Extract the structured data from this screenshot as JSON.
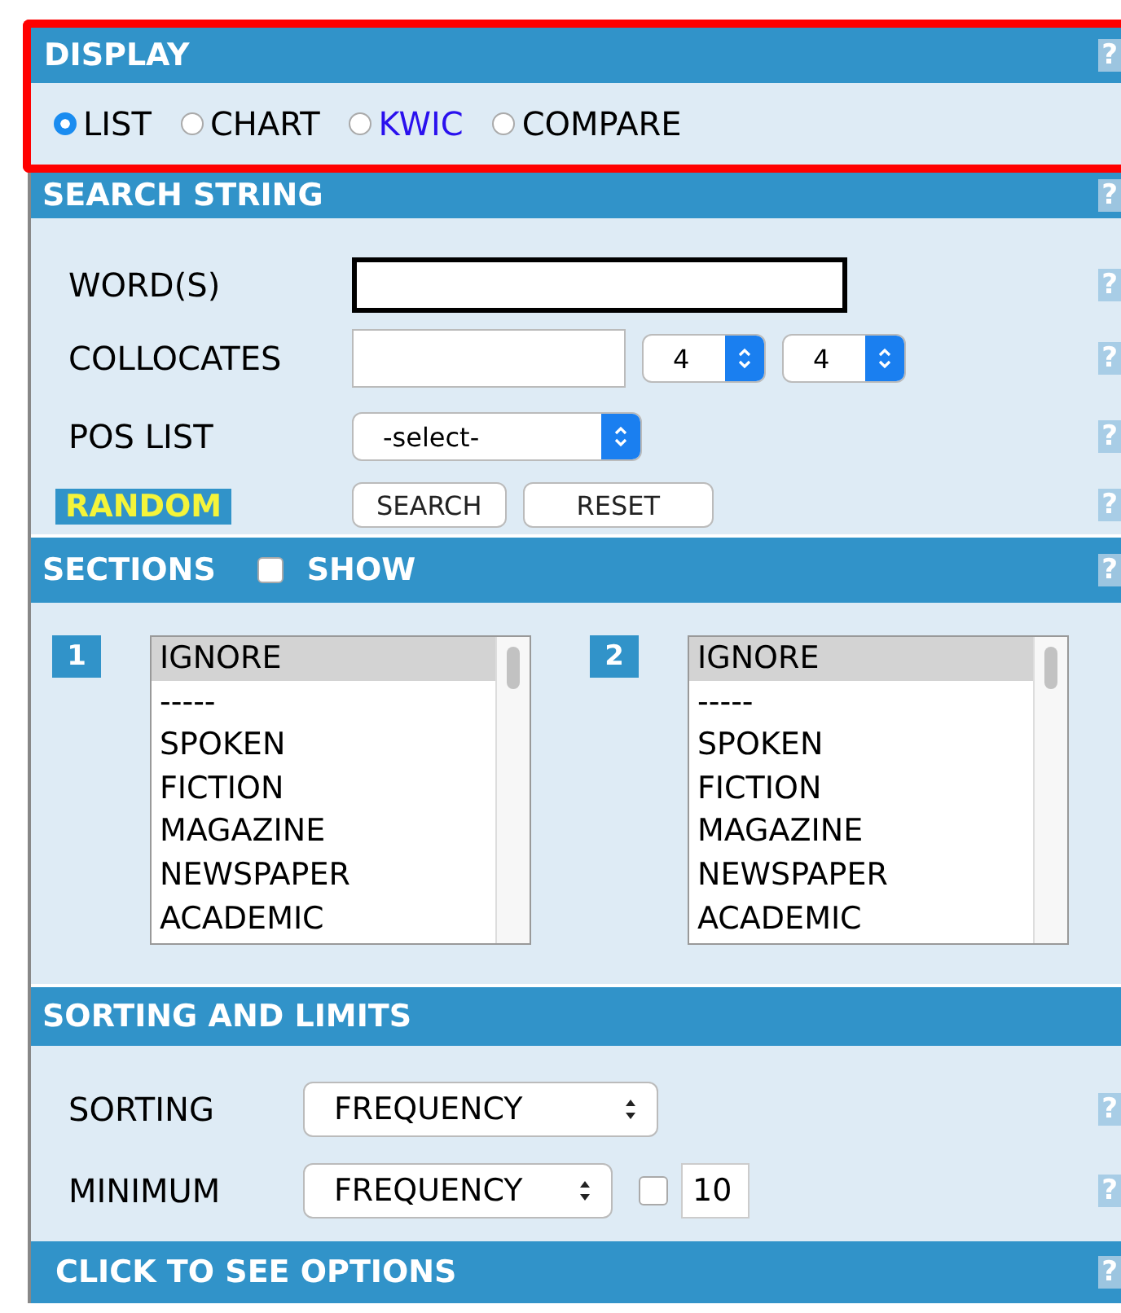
{
  "display": {
    "title": "DISPLAY",
    "help": "?",
    "options": [
      {
        "label": "LIST",
        "selected": true,
        "kind": "text"
      },
      {
        "label": "CHART",
        "selected": false,
        "kind": "text"
      },
      {
        "label": "KWIC",
        "selected": false,
        "kind": "link"
      },
      {
        "label": "COMPARE",
        "selected": false,
        "kind": "text"
      }
    ]
  },
  "search_string": {
    "title": "SEARCH STRING",
    "help": "?",
    "words": {
      "label": "WORD(S)",
      "help": "?"
    },
    "collocates": {
      "label": "COLLOCATES",
      "left_span": "4",
      "right_span": "4",
      "help": "?"
    },
    "pos_list": {
      "label": "POS LIST",
      "value": "-select-",
      "help": "?"
    },
    "random": {
      "label": "RANDOM",
      "help": "?"
    },
    "buttons": [
      "SEARCH",
      "RESET"
    ]
  },
  "sections": {
    "title": "SECTIONS",
    "show_label": "SHOW",
    "show_checked": false,
    "help": "?",
    "lists": [
      {
        "number": "1",
        "items": [
          {
            "label": "IGNORE",
            "selected": true
          },
          {
            "label": "-----",
            "selected": false
          },
          {
            "label": "SPOKEN",
            "selected": false
          },
          {
            "label": "FICTION",
            "selected": false
          },
          {
            "label": "MAGAZINE",
            "selected": false
          },
          {
            "label": "NEWSPAPER",
            "selected": false
          },
          {
            "label": "ACADEMIC",
            "selected": false
          }
        ]
      },
      {
        "number": "2",
        "items": [
          {
            "label": "IGNORE",
            "selected": true
          },
          {
            "label": "-----",
            "selected": false
          },
          {
            "label": "SPOKEN",
            "selected": false
          },
          {
            "label": "FICTION",
            "selected": false
          },
          {
            "label": "MAGAZINE",
            "selected": false
          },
          {
            "label": "NEWSPAPER",
            "selected": false
          },
          {
            "label": "ACADEMIC",
            "selected": false
          }
        ]
      }
    ]
  },
  "sorting_and_limits": {
    "title": "SORTING AND LIMITS",
    "sorting": {
      "label": "SORTING",
      "value": "FREQUENCY",
      "help": "?"
    },
    "minimum": {
      "label": "MINIMUM",
      "value": "FREQUENCY",
      "checked": false,
      "amount": "10",
      "help": "?"
    }
  },
  "options": {
    "title": "CLICK TO SEE OPTIONS",
    "help": "?"
  }
}
